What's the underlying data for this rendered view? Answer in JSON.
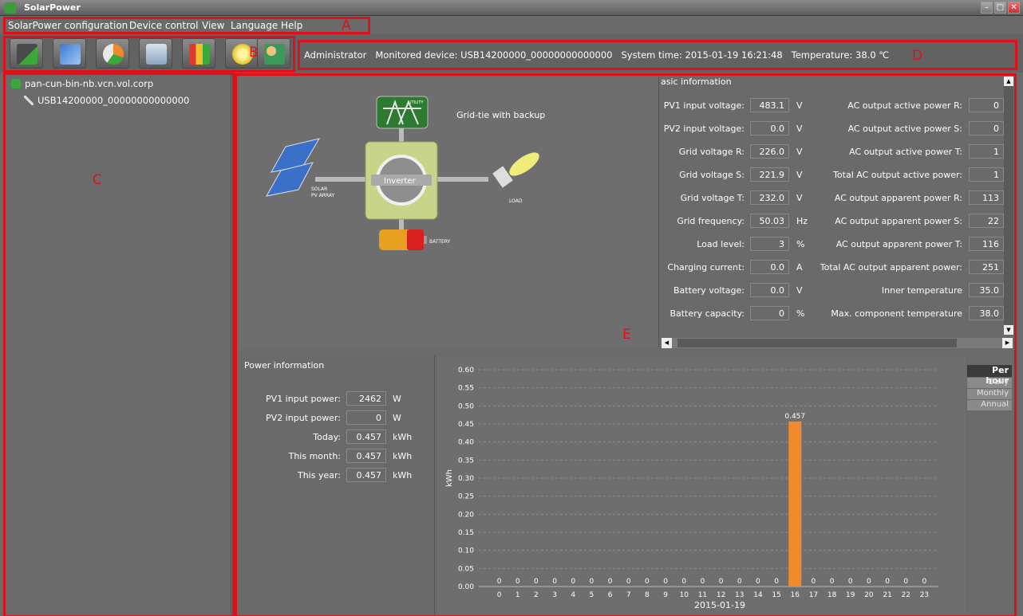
{
  "window": {
    "title": "SolarPower"
  },
  "menu": [
    "SolarPower configuration",
    "Device control",
    "View",
    "Language",
    "Help"
  ],
  "status": {
    "user": "Administrator",
    "device_label": "Monitored device:",
    "device": "USB14200000_00000000000000",
    "time_label": "System time:",
    "time": "2015-01-19 16:21:48",
    "temp_label": "Temperature:",
    "temp": "38.0 ℃"
  },
  "tree": {
    "host": "pan-cun-bin-nb.vcn.vol.corp",
    "device": "USB14200000_00000000000000"
  },
  "diagram": {
    "mode": "Grid-tie with backup",
    "utility": "UTILITY",
    "inverter": "Inverter",
    "solar": "SOLAR",
    "pv_array": "PV ARRAY",
    "load": "LOAD",
    "battery": "BATTERY"
  },
  "basic_info": {
    "title": "asic information",
    "left": [
      {
        "label": "PV1 input voltage:",
        "value": "483.1",
        "unit": "V"
      },
      {
        "label": "PV2 input voltage:",
        "value": "0.0",
        "unit": "V"
      },
      {
        "label": "Grid voltage R:",
        "value": "226.0",
        "unit": "V"
      },
      {
        "label": "Grid voltage S:",
        "value": "221.9",
        "unit": "V"
      },
      {
        "label": "Grid voltage T:",
        "value": "232.0",
        "unit": "V"
      },
      {
        "label": "Grid frequency:",
        "value": "50.03",
        "unit": "Hz"
      },
      {
        "label": "Load level:",
        "value": "3",
        "unit": "%"
      },
      {
        "label": "Charging current:",
        "value": "0.0",
        "unit": "A"
      },
      {
        "label": "Battery voltage:",
        "value": "0.0",
        "unit": "V"
      },
      {
        "label": "Battery capacity:",
        "value": "0",
        "unit": "%"
      }
    ],
    "right": [
      {
        "label": "AC output active power R:",
        "value": "0"
      },
      {
        "label": "AC output active power S:",
        "value": "0"
      },
      {
        "label": "AC output active power T:",
        "value": "1"
      },
      {
        "label": "Total AC output active power:",
        "value": "1"
      },
      {
        "label": "AC output apparent power R:",
        "value": "113"
      },
      {
        "label": "AC output apparent power S:",
        "value": "22"
      },
      {
        "label": "AC output apparent power T:",
        "value": "116"
      },
      {
        "label": "Total AC output apparent power:",
        "value": "251"
      },
      {
        "label": "Inner temperature",
        "value": "35.0"
      },
      {
        "label": "Max. component temperature",
        "value": "38.0"
      }
    ]
  },
  "power_info": {
    "title": "Power information",
    "rows": [
      {
        "label": "PV1 input power:",
        "value": "2462",
        "unit": "W"
      },
      {
        "label": "PV2 input power:",
        "value": "0",
        "unit": "W"
      },
      {
        "label": "Today:",
        "value": "0.457",
        "unit": "kWh"
      },
      {
        "label": "This month:",
        "value": "0.457",
        "unit": "kWh"
      },
      {
        "label": "This year:",
        "value": "0.457",
        "unit": "kWh"
      }
    ]
  },
  "period_buttons": [
    "Per hour",
    "Daily",
    "Monthly",
    "Annual"
  ],
  "annotations": [
    "A",
    "B",
    "C",
    "D",
    "E"
  ],
  "colors": {
    "bar": "#f08a2c",
    "annotation": "#e0101a",
    "background": "#6b6b6b"
  },
  "chart_data": {
    "type": "bar",
    "title": "",
    "xlabel": "2015-01-19",
    "ylabel": "kWh",
    "ylim": [
      0,
      0.6
    ],
    "yticks": [
      "0.00",
      "0.05",
      "0.10",
      "0.15",
      "0.20",
      "0.25",
      "0.30",
      "0.35",
      "0.40",
      "0.45",
      "0.50",
      "0.55",
      "0.60"
    ],
    "categories": [
      "0",
      "1",
      "2",
      "3",
      "4",
      "5",
      "6",
      "7",
      "8",
      "9",
      "10",
      "11",
      "12",
      "13",
      "14",
      "15",
      "16",
      "17",
      "18",
      "19",
      "20",
      "21",
      "22",
      "23"
    ],
    "values": [
      0,
      0,
      0,
      0,
      0,
      0,
      0,
      0,
      0,
      0,
      0,
      0,
      0,
      0,
      0,
      0,
      0.457,
      0,
      0,
      0,
      0,
      0,
      0,
      0
    ],
    "data_labels": [
      "0",
      "0",
      "0",
      "0",
      "0",
      "0",
      "0",
      "0",
      "0",
      "0",
      "0",
      "0",
      "0",
      "0",
      "0",
      "0",
      "0.457",
      "0",
      "0",
      "0",
      "0",
      "0",
      "0",
      "0"
    ]
  }
}
